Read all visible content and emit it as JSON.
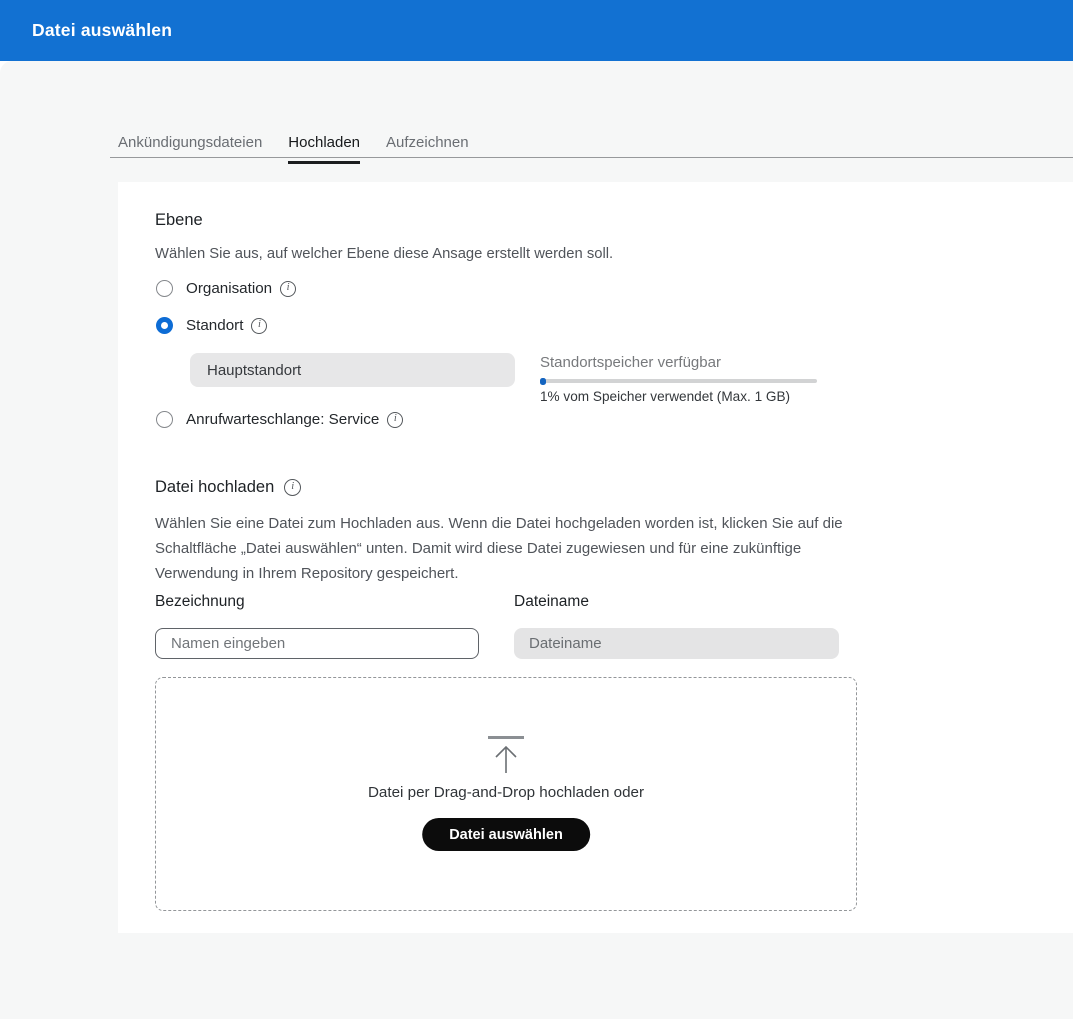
{
  "header": {
    "title": "Datei auswählen"
  },
  "tabs": {
    "announcement": {
      "label": "Ankündigungsdateien"
    },
    "upload": {
      "label": "Hochladen"
    },
    "record": {
      "label": "Aufzeichnen"
    }
  },
  "level_section": {
    "title": "Ebene",
    "description": "Wählen Sie aus, auf welcher Ebene diese Ansage erstellt werden soll.",
    "options": {
      "organisation": {
        "label": "Organisation",
        "selected": false
      },
      "standort": {
        "label": "Standort",
        "selected": true
      },
      "queue": {
        "label": "Anrufwarteschlange: Service",
        "selected": false
      }
    },
    "location_select": {
      "value": "Hauptstandort"
    },
    "storage": {
      "label": "Standortspeicher verfügbar",
      "percent_used": 1,
      "usage_text": "1% vom Speicher verwendet (Max. 1 GB)"
    }
  },
  "upload_section": {
    "title": "Datei hochladen",
    "description": "Wählen Sie eine Datei zum Hochladen aus. Wenn die Datei hochgeladen worden ist, klicken Sie auf die Schaltfläche „Datei auswählen“ unten. Damit wird diese Datei zugewiesen und für eine zukünftige Verwendung in Ihrem Repository gespeichert.",
    "name_field": {
      "label": "Bezeichnung",
      "placeholder": "Namen eingeben",
      "value": ""
    },
    "filename_field": {
      "label": "Dateiname",
      "placeholder": "Dateiname",
      "value": "",
      "disabled": true
    },
    "dropzone": {
      "text": "Datei per Drag-and-Drop hochladen oder",
      "button_label": "Datei auswählen"
    }
  },
  "icons": {
    "info": "info-circle",
    "upload": "upload-arrow"
  },
  "colors": {
    "header_blue": "#1271d2",
    "radio_blue": "#0d6cd5",
    "progress_blue": "#1464c0",
    "button_black": "#0c0c0c"
  }
}
